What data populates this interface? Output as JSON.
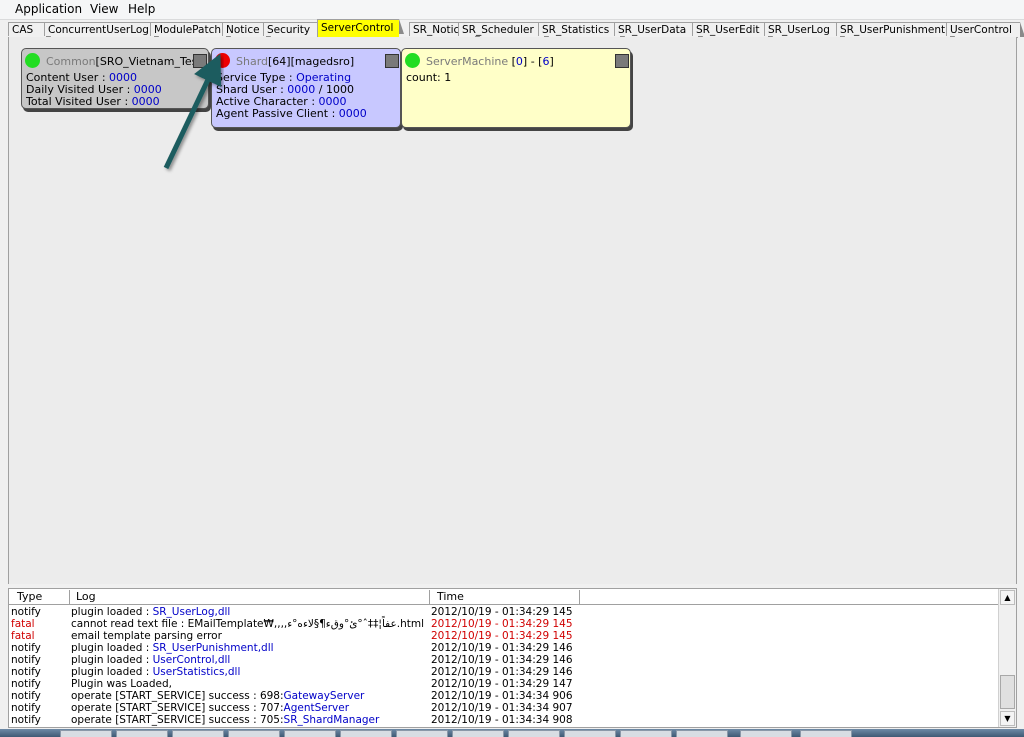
{
  "menu": [
    "Application",
    "View",
    "Help"
  ],
  "tabs": [
    "CAS",
    "ConcurrentUserLog",
    "ModulePatch",
    "Notice",
    "Security",
    "ServerControl",
    "SR_Notice",
    "SR_Scheduler",
    "SR_Statistics",
    "SR_UserData",
    "SR_UserEdit",
    "SR_UserLog",
    "SR_UserPunishment",
    "UserControl"
  ],
  "active_tab": "ServerControl",
  "cards": {
    "common": {
      "status_color": "#22dd22",
      "title_type": "Common",
      "title_name": "[SRO_Vietnam_TestL",
      "content_label": "Content User : ",
      "content_value": "0000",
      "daily_label": "Daily Visited User : ",
      "daily_value": "0000",
      "total_label": "Total Visited User : ",
      "total_value": "0000"
    },
    "shard": {
      "status_color": "#ee0000",
      "title_type": "Shard",
      "title_name": "[64][magedsro]",
      "service_label": "Service Type : ",
      "service_value": "Operating",
      "shard_user_label": "Shard User : ",
      "shard_user_value": "0000",
      "shard_user_max": " / 1000",
      "active_label": "Active Character : ",
      "active_value": "0000",
      "agent_label": "Agent Passive Client : ",
      "agent_value": "0000"
    },
    "machine": {
      "status_color": "#22dd22",
      "title_type": "ServerMachine",
      "title_range_a": " [",
      "title_range_v1": "0",
      "title_range_b": "] - [",
      "title_range_v2": "6",
      "title_range_c": "]",
      "count_label": "count: 1"
    }
  },
  "log": {
    "columns": [
      "Type",
      "Log",
      "Time"
    ],
    "rows": [
      {
        "type": "notify",
        "text": "plugin loaded : ",
        "link": "SR_UserLog,dll",
        "time": "2012/10/19 - 01:34:29 145"
      },
      {
        "type": "fatal",
        "text": "cannot read text file : EMailTemplate₩,,,,عفاً¦‡‡ˆ°ئ°وقء¶§لاءه°ء.html",
        "link": "",
        "time": "2012/10/19 - 01:34:29 145"
      },
      {
        "type": "fatal",
        "text": "email template parsing error",
        "link": "",
        "time": "2012/10/19 - 01:34:29 145"
      },
      {
        "type": "notify",
        "text": "plugin loaded : ",
        "link": "SR_UserPunishment,dll",
        "time": "2012/10/19 - 01:34:29 146"
      },
      {
        "type": "notify",
        "text": "plugin loaded : ",
        "link": "UserControl,dll",
        "time": "2012/10/19 - 01:34:29 146"
      },
      {
        "type": "notify",
        "text": "plugin loaded : ",
        "link": "UserStatistics,dll",
        "time": "2012/10/19 - 01:34:29 146"
      },
      {
        "type": "notify",
        "text": "Plugin was Loaded,",
        "link": "",
        "time": "2012/10/19 - 01:34:29 147"
      },
      {
        "type": "notify",
        "text": "operate [START_SERVICE] success : 698:",
        "link": "GatewayServer",
        "time": "2012/10/19 - 01:34:34 906"
      },
      {
        "type": "notify",
        "text": "operate [START_SERVICE] success : 707:",
        "link": "AgentServer",
        "time": "2012/10/19 - 01:34:34 907"
      },
      {
        "type": "notify",
        "text": "operate [START_SERVICE] success : 705:",
        "link": "SR_ShardManager",
        "time": "2012/10/19 - 01:34:34 908"
      }
    ]
  },
  "colors": {
    "accent_tab": "#ffff00",
    "link": "#0000c8",
    "fatal": "#d00000",
    "arrow": "#1f5c5e"
  }
}
